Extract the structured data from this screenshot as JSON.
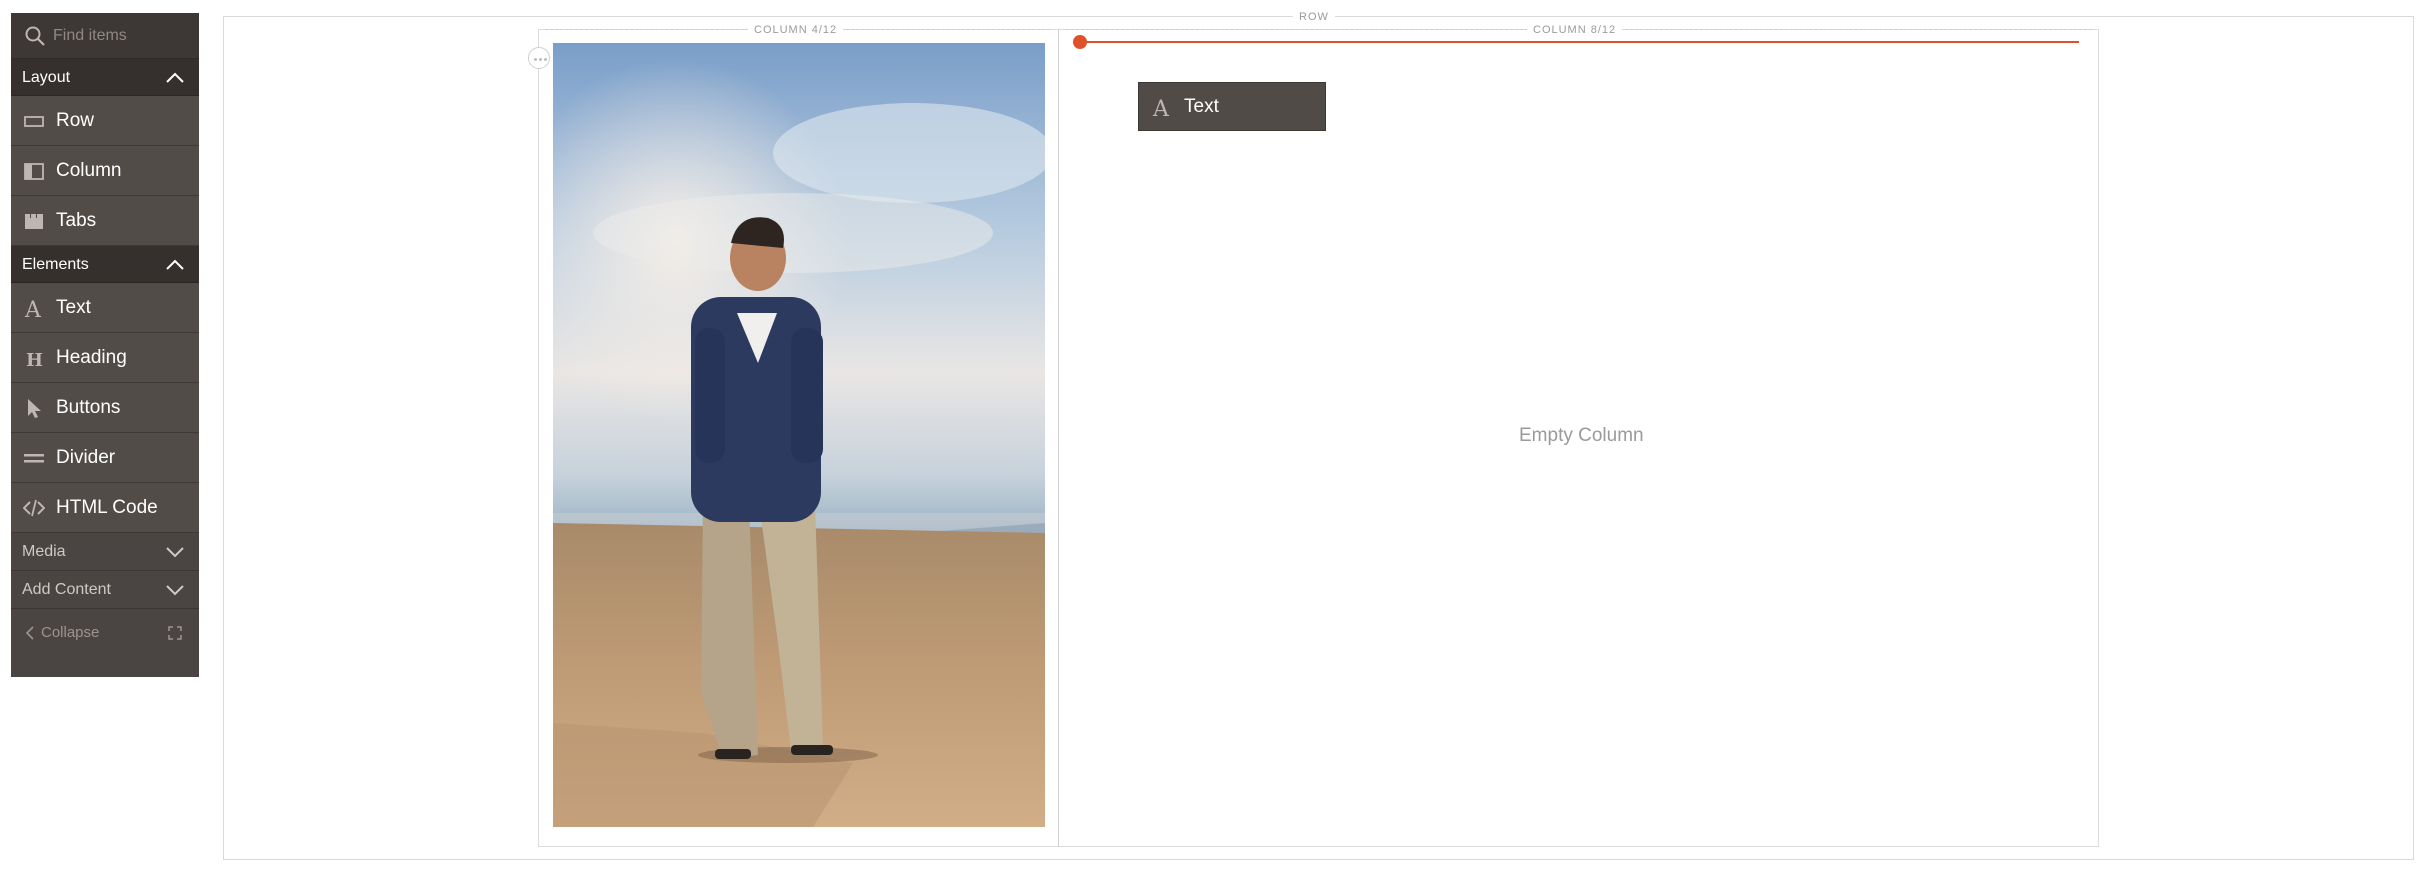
{
  "sidebar": {
    "search_placeholder": "Find items",
    "groups": [
      {
        "label": "Layout",
        "expanded": true,
        "items": [
          {
            "label": "Row",
            "icon": "row-icon"
          },
          {
            "label": "Column",
            "icon": "column-icon"
          },
          {
            "label": "Tabs",
            "icon": "tabs-icon"
          }
        ]
      },
      {
        "label": "Elements",
        "expanded": true,
        "items": [
          {
            "label": "Text",
            "icon": "text-icon"
          },
          {
            "label": "Heading",
            "icon": "heading-icon"
          },
          {
            "label": "Buttons",
            "icon": "pointer-icon"
          },
          {
            "label": "Divider",
            "icon": "divider-icon"
          },
          {
            "label": "HTML Code",
            "icon": "code-icon"
          }
        ]
      },
      {
        "label": "Media",
        "expanded": false
      },
      {
        "label": "Add Content",
        "expanded": false
      }
    ],
    "collapse_label": "Collapse"
  },
  "stage": {
    "row_label": "ROW",
    "column_left_label": "COLUMN 4/12",
    "column_right_label": "COLUMN 8/12",
    "empty_column_text": "Empty Column",
    "dragged_item": {
      "label": "Text",
      "icon": "text-icon"
    }
  },
  "colors": {
    "panel_bg": "#4a4542",
    "group_bg": "#35302d",
    "item_bg": "#524c48",
    "accent": "#e0512b"
  }
}
